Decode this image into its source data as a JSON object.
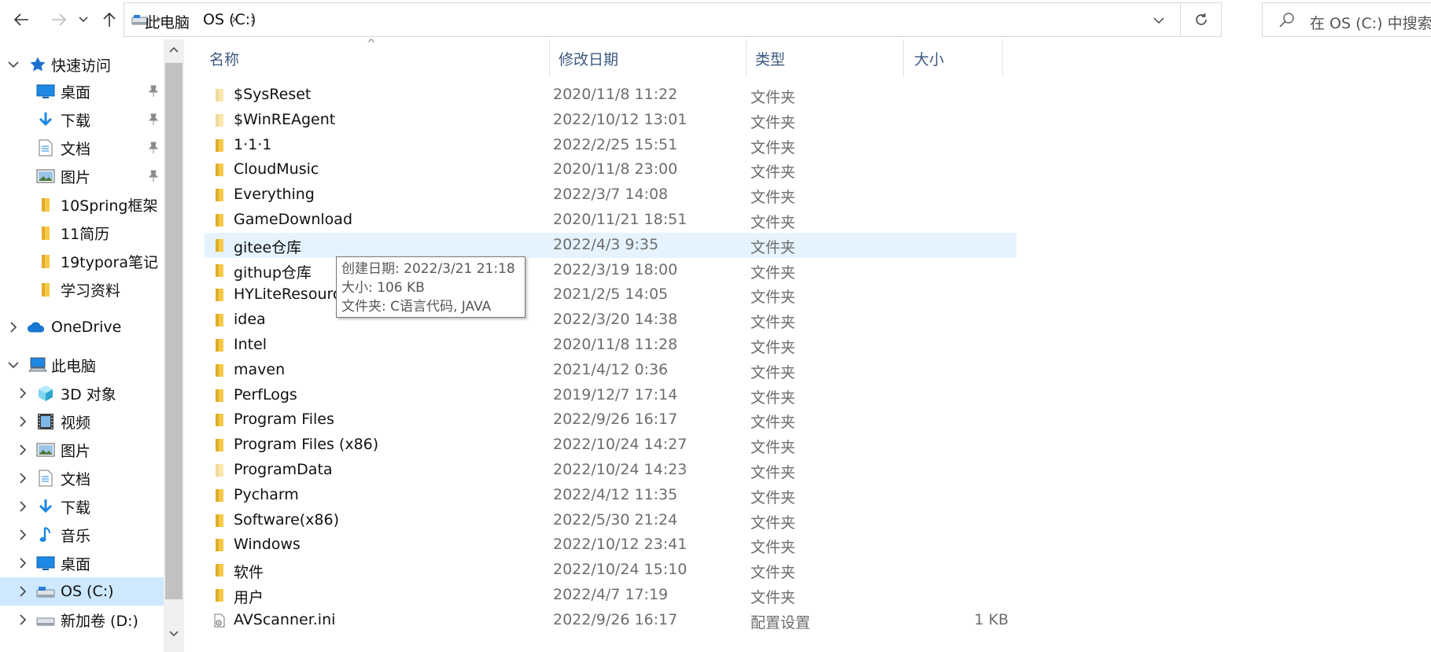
{
  "window": {
    "title": "OS (C:)"
  },
  "toolbar": {
    "back_icon": "arrow-left-icon",
    "forward_icon": "arrow-right-icon",
    "recent_icon": "chevron-down-icon",
    "up_icon": "arrow-up-icon"
  },
  "address": {
    "crumbs": [
      "此电脑",
      "OS (C:)"
    ],
    "refresh_icon": "refresh-icon"
  },
  "search": {
    "placeholder": "在 OS (C:) 中搜索"
  },
  "navpane": {
    "quick_access": {
      "label": "快速访问",
      "items": [
        {
          "label": "桌面",
          "icon": "desktop-icon",
          "pinned": true
        },
        {
          "label": "下载",
          "icon": "download-icon",
          "pinned": true
        },
        {
          "label": "文档",
          "icon": "document-icon",
          "pinned": true
        },
        {
          "label": "图片",
          "icon": "pictures-icon",
          "pinned": true
        },
        {
          "label": "10Spring框架",
          "icon": "folder-icon",
          "pinned": false
        },
        {
          "label": "11简历",
          "icon": "folder-icon",
          "pinned": false
        },
        {
          "label": "19typora笔记",
          "icon": "folder-icon",
          "pinned": false
        },
        {
          "label": "学习资料",
          "icon": "folder-icon",
          "pinned": false
        }
      ]
    },
    "onedrive": {
      "label": "OneDrive"
    },
    "this_pc": {
      "label": "此电脑",
      "items": [
        {
          "label": "3D 对象",
          "icon": "3d-objects-icon"
        },
        {
          "label": "视频",
          "icon": "video-icon"
        },
        {
          "label": "图片",
          "icon": "pictures-icon"
        },
        {
          "label": "文档",
          "icon": "document-icon"
        },
        {
          "label": "下载",
          "icon": "download-icon"
        },
        {
          "label": "音乐",
          "icon": "music-icon"
        },
        {
          "label": "桌面",
          "icon": "desktop-icon"
        },
        {
          "label": "OS (C:)",
          "icon": "drive-icon",
          "selected": true
        },
        {
          "label": "新加卷 (D:)",
          "icon": "drive-icon"
        }
      ]
    }
  },
  "filelist": {
    "columns": {
      "name": "名称",
      "date": "修改日期",
      "type": "类型",
      "size": "大小"
    },
    "rows": [
      {
        "name": "$SysReset",
        "date": "2020/11/8 11:22",
        "type": "文件夹",
        "size": "",
        "icon": "folder-icon",
        "faded": true
      },
      {
        "name": "$WinREAgent",
        "date": "2022/10/12 13:01",
        "type": "文件夹",
        "size": "",
        "icon": "folder-icon",
        "faded": true
      },
      {
        "name": "1·1·1",
        "date": "2022/2/25 15:51",
        "type": "文件夹",
        "size": "",
        "icon": "folder-icon"
      },
      {
        "name": "CloudMusic",
        "date": "2020/11/8 23:00",
        "type": "文件夹",
        "size": "",
        "icon": "folder-icon"
      },
      {
        "name": "Everything",
        "date": "2022/3/7 14:08",
        "type": "文件夹",
        "size": "",
        "icon": "folder-icon"
      },
      {
        "name": "GameDownload",
        "date": "2020/11/21 18:51",
        "type": "文件夹",
        "size": "",
        "icon": "folder-icon"
      },
      {
        "name": "gitee仓库",
        "date": "2022/4/3 9:35",
        "type": "文件夹",
        "size": "",
        "icon": "folder-icon",
        "hover": true
      },
      {
        "name": "githup仓库",
        "date": "2022/3/19 18:00",
        "type": "文件夹",
        "size": "",
        "icon": "folder-icon"
      },
      {
        "name": "HYLiteResource",
        "date": "2021/2/5 14:05",
        "type": "文件夹",
        "size": "",
        "icon": "folder-icon"
      },
      {
        "name": "idea",
        "date": "2022/3/20 14:38",
        "type": "文件夹",
        "size": "",
        "icon": "folder-icon"
      },
      {
        "name": "Intel",
        "date": "2020/11/8 11:28",
        "type": "文件夹",
        "size": "",
        "icon": "folder-icon"
      },
      {
        "name": "maven",
        "date": "2021/4/12 0:36",
        "type": "文件夹",
        "size": "",
        "icon": "folder-icon"
      },
      {
        "name": "PerfLogs",
        "date": "2019/12/7 17:14",
        "type": "文件夹",
        "size": "",
        "icon": "folder-icon"
      },
      {
        "name": "Program Files",
        "date": "2022/9/26 16:17",
        "type": "文件夹",
        "size": "",
        "icon": "folder-icon"
      },
      {
        "name": "Program Files (x86)",
        "date": "2022/10/24 14:27",
        "type": "文件夹",
        "size": "",
        "icon": "folder-icon"
      },
      {
        "name": "ProgramData",
        "date": "2022/10/24 14:23",
        "type": "文件夹",
        "size": "",
        "icon": "folder-icon",
        "faded": true
      },
      {
        "name": "Pycharm",
        "date": "2022/4/12 11:35",
        "type": "文件夹",
        "size": "",
        "icon": "folder-icon"
      },
      {
        "name": "Software(x86)",
        "date": "2022/5/30 21:24",
        "type": "文件夹",
        "size": "",
        "icon": "folder-icon"
      },
      {
        "name": "Windows",
        "date": "2022/10/12 23:41",
        "type": "文件夹",
        "size": "",
        "icon": "folder-icon"
      },
      {
        "name": "软件",
        "date": "2022/10/24 15:10",
        "type": "文件夹",
        "size": "",
        "icon": "folder-icon"
      },
      {
        "name": "用户",
        "date": "2022/4/7 17:19",
        "type": "文件夹",
        "size": "",
        "icon": "folder-icon"
      },
      {
        "name": "AVScanner.ini",
        "date": "2022/9/26 16:17",
        "type": "配置设置",
        "size": "1 KB",
        "icon": "settings-file-icon"
      }
    ]
  },
  "tooltip": {
    "line1": "创建日期: 2022/3/21 21:18",
    "line2": "大小: 106 KB",
    "line3": "文件夹: C语言代码, JAVA"
  },
  "colors": {
    "selection": "#cde8ff",
    "hover": "#e5f3ff",
    "folder": "#f7c948",
    "header_text": "#3d5a80"
  }
}
